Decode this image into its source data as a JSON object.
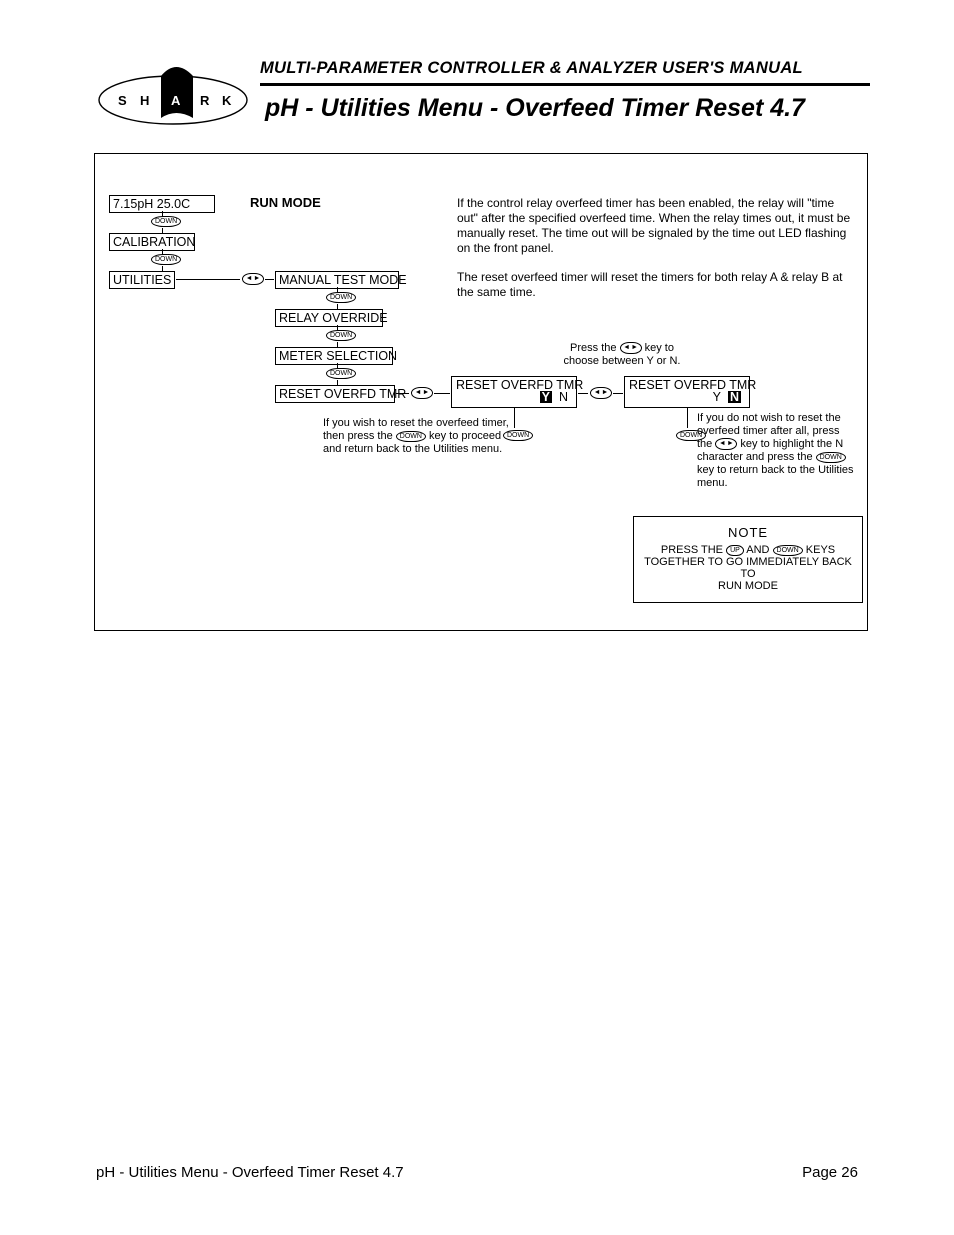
{
  "header": {
    "overline": "MULTI-PARAMETER CONTROLLER & ANALYZER USER'S MANUAL",
    "title": "pH - Utilities Menu - Overfeed Timer Reset 4.7"
  },
  "logo": {
    "letters": [
      "S",
      "H",
      "A",
      "R",
      "K"
    ]
  },
  "flow": {
    "run_mode_box": "7.15pH  25.0C",
    "run_mode_label": "RUN MODE",
    "calibration": "CALIBRATION",
    "utilities": "UTILITIES",
    "manual_test_mode": "MANUAL TEST MODE",
    "relay_override": "RELAY OVERRIDE",
    "meter_selection": "METER SELECTION",
    "reset_overfd_tmr": "RESET OVERFD TMR",
    "reset_left_box_top": "RESET OVERFD TMR",
    "reset_left_box_yn_y": "Y",
    "reset_left_box_yn_n": "N",
    "reset_right_box_top": "RESET OVERFD TMR",
    "reset_right_box_yn_y": "Y",
    "reset_right_box_yn_n": "N"
  },
  "keys": {
    "down": "DOWN",
    "up": "UP"
  },
  "body": {
    "p1": "If the control relay overfeed timer has been enabled, the relay will \"time out\" after the specified overfeed time. When the relay times out, it must be manually reset. The time out will be signaled by the time out LED flashing on the front panel.",
    "p2": "The reset overfeed timer will reset the timers for both relay A & relay B at the same time.",
    "choose_pre": "Press the ",
    "choose_post": " key to",
    "choose_line2": "choose between Y or N.",
    "left_pre": "If you wish to reset the overfeed timer,",
    "left_mid1": "then press the ",
    "left_mid2": " key to  proceed",
    "left_after": "and return back to the Utilities menu.",
    "right_l1": "If you do not wish to reset the",
    "right_l2": "overfeed timer after all, press",
    "right_l3a": "the ",
    "right_l3b": " key to highlight the N",
    "right_l4a": "character and press the ",
    "right_l5": "key to return back to the Utilities",
    "right_l6": "menu."
  },
  "note": {
    "title": "NOTE",
    "l1a": "PRESS THE ",
    "l1b": " AND ",
    "l1c": " KEYS",
    "l2": "TOGETHER TO GO IMMEDIATELY BACK TO",
    "l3": "RUN MODE"
  },
  "footer": {
    "left": "pH - Utilities Menu - Overfeed Timer Reset 4.7",
    "right": "Page 26"
  }
}
